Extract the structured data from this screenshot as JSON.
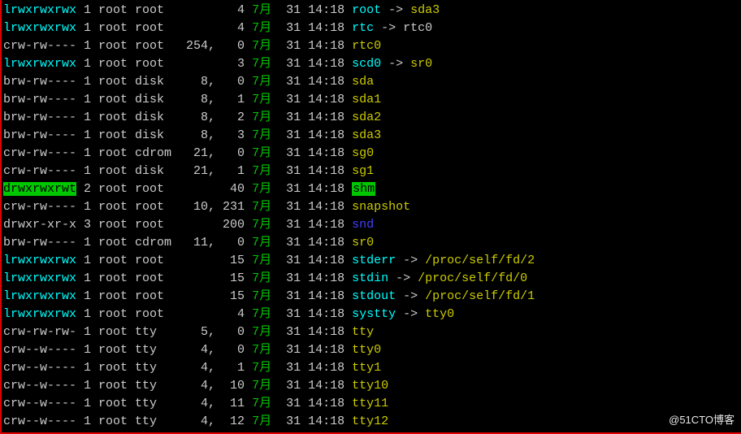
{
  "watermark": "@51CTO博客",
  "month_label": "7月",
  "rows": [
    {
      "perm": "lrwxrwxrwx",
      "perm_style": "perm-lnk",
      "links": "1",
      "owner": "root",
      "group": "root",
      "major": "",
      "size": "4",
      "day": "31",
      "time": "14:18",
      "name": "root",
      "name_style": "fname-cyan",
      "arrow": true,
      "target": "sda3",
      "target_style": "target-yellow"
    },
    {
      "perm": "lrwxrwxrwx",
      "perm_style": "perm-lnk",
      "links": "1",
      "owner": "root",
      "group": "root",
      "major": "",
      "size": "4",
      "day": "31",
      "time": "14:18",
      "name": "rtc",
      "name_style": "fname-cyan",
      "arrow": true,
      "target": "rtc0",
      "target_style": "target-plain"
    },
    {
      "perm": "crw-rw----",
      "perm_style": "plain",
      "links": "1",
      "owner": "root",
      "group": "root",
      "major": "254,",
      "size": "0",
      "day": "31",
      "time": "14:18",
      "name": "rtc0",
      "name_style": "fname-yellow",
      "arrow": false,
      "target": "",
      "target_style": ""
    },
    {
      "perm": "lrwxrwxrwx",
      "perm_style": "perm-lnk",
      "links": "1",
      "owner": "root",
      "group": "root",
      "major": "",
      "size": "3",
      "day": "31",
      "time": "14:18",
      "name": "scd0",
      "name_style": "fname-cyan",
      "arrow": true,
      "target": "sr0",
      "target_style": "target-yellow"
    },
    {
      "perm": "brw-rw----",
      "perm_style": "plain",
      "links": "1",
      "owner": "root",
      "group": "disk",
      "major": "8,",
      "size": "0",
      "day": "31",
      "time": "14:18",
      "name": "sda",
      "name_style": "fname-yellow",
      "arrow": false,
      "target": "",
      "target_style": ""
    },
    {
      "perm": "brw-rw----",
      "perm_style": "plain",
      "links": "1",
      "owner": "root",
      "group": "disk",
      "major": "8,",
      "size": "1",
      "day": "31",
      "time": "14:18",
      "name": "sda1",
      "name_style": "fname-yellow",
      "arrow": false,
      "target": "",
      "target_style": ""
    },
    {
      "perm": "brw-rw----",
      "perm_style": "plain",
      "links": "1",
      "owner": "root",
      "group": "disk",
      "major": "8,",
      "size": "2",
      "day": "31",
      "time": "14:18",
      "name": "sda2",
      "name_style": "fname-yellow",
      "arrow": false,
      "target": "",
      "target_style": ""
    },
    {
      "perm": "brw-rw----",
      "perm_style": "plain",
      "links": "1",
      "owner": "root",
      "group": "disk",
      "major": "8,",
      "size": "3",
      "day": "31",
      "time": "14:18",
      "name": "sda3",
      "name_style": "fname-yellow",
      "arrow": false,
      "target": "",
      "target_style": ""
    },
    {
      "perm": "crw-rw----",
      "perm_style": "plain",
      "links": "1",
      "owner": "root",
      "group": "cdrom",
      "major": "21,",
      "size": "0",
      "day": "31",
      "time": "14:18",
      "name": "sg0",
      "name_style": "fname-yellow",
      "arrow": false,
      "target": "",
      "target_style": ""
    },
    {
      "perm": "crw-rw----",
      "perm_style": "plain",
      "links": "1",
      "owner": "root",
      "group": "disk",
      "major": "21,",
      "size": "1",
      "day": "31",
      "time": "14:18",
      "name": "sg1",
      "name_style": "fname-yellow",
      "arrow": false,
      "target": "",
      "target_style": ""
    },
    {
      "perm": "drwxrwxrwt",
      "perm_style": "perm-drwt",
      "links": "2",
      "owner": "root",
      "group": "root",
      "major": "",
      "size": "40",
      "day": "31",
      "time": "14:18",
      "name": "shm",
      "name_style": "fname-bg-green",
      "arrow": false,
      "target": "",
      "target_style": ""
    },
    {
      "perm": "crw-rw----",
      "perm_style": "plain",
      "links": "1",
      "owner": "root",
      "group": "root",
      "major": "10,",
      "size": "231",
      "day": "31",
      "time": "14:18",
      "name": "snapshot",
      "name_style": "fname-yellow",
      "arrow": false,
      "target": "",
      "target_style": ""
    },
    {
      "perm": "drwxr-xr-x",
      "perm_style": "plain",
      "links": "3",
      "owner": "root",
      "group": "root",
      "major": "",
      "size": "200",
      "day": "31",
      "time": "14:18",
      "name": "snd",
      "name_style": "fname-blue",
      "arrow": false,
      "target": "",
      "target_style": ""
    },
    {
      "perm": "brw-rw----",
      "perm_style": "plain",
      "links": "1",
      "owner": "root",
      "group": "cdrom",
      "major": "11,",
      "size": "0",
      "day": "31",
      "time": "14:18",
      "name": "sr0",
      "name_style": "fname-yellow",
      "arrow": false,
      "target": "",
      "target_style": ""
    },
    {
      "perm": "lrwxrwxrwx",
      "perm_style": "perm-lnk",
      "links": "1",
      "owner": "root",
      "group": "root",
      "major": "",
      "size": "15",
      "day": "31",
      "time": "14:18",
      "name": "stderr",
      "name_style": "fname-cyan",
      "arrow": true,
      "target": "/proc/self/fd/2",
      "target_style": "target-yellow"
    },
    {
      "perm": "lrwxrwxrwx",
      "perm_style": "perm-lnk",
      "links": "1",
      "owner": "root",
      "group": "root",
      "major": "",
      "size": "15",
      "day": "31",
      "time": "14:18",
      "name": "stdin",
      "name_style": "fname-cyan",
      "arrow": true,
      "target": "/proc/self/fd/0",
      "target_style": "target-yellow"
    },
    {
      "perm": "lrwxrwxrwx",
      "perm_style": "perm-lnk",
      "links": "1",
      "owner": "root",
      "group": "root",
      "major": "",
      "size": "15",
      "day": "31",
      "time": "14:18",
      "name": "stdout",
      "name_style": "fname-cyan",
      "arrow": true,
      "target": "/proc/self/fd/1",
      "target_style": "target-yellow"
    },
    {
      "perm": "lrwxrwxrwx",
      "perm_style": "perm-lnk",
      "links": "1",
      "owner": "root",
      "group": "root",
      "major": "",
      "size": "4",
      "day": "31",
      "time": "14:18",
      "name": "systty",
      "name_style": "fname-cyan",
      "arrow": true,
      "target": "tty0",
      "target_style": "target-yellow"
    },
    {
      "perm": "crw-rw-rw-",
      "perm_style": "plain",
      "links": "1",
      "owner": "root",
      "group": "tty",
      "major": "5,",
      "size": "0",
      "day": "31",
      "time": "14:18",
      "name": "tty",
      "name_style": "fname-yellow",
      "arrow": false,
      "target": "",
      "target_style": ""
    },
    {
      "perm": "crw--w----",
      "perm_style": "plain",
      "links": "1",
      "owner": "root",
      "group": "tty",
      "major": "4,",
      "size": "0",
      "day": "31",
      "time": "14:18",
      "name": "tty0",
      "name_style": "fname-yellow",
      "arrow": false,
      "target": "",
      "target_style": ""
    },
    {
      "perm": "crw--w----",
      "perm_style": "plain",
      "links": "1",
      "owner": "root",
      "group": "tty",
      "major": "4,",
      "size": "1",
      "day": "31",
      "time": "14:18",
      "name": "tty1",
      "name_style": "fname-yellow",
      "arrow": false,
      "target": "",
      "target_style": ""
    },
    {
      "perm": "crw--w----",
      "perm_style": "plain",
      "links": "1",
      "owner": "root",
      "group": "tty",
      "major": "4,",
      "size": "10",
      "day": "31",
      "time": "14:18",
      "name": "tty10",
      "name_style": "fname-yellow",
      "arrow": false,
      "target": "",
      "target_style": ""
    },
    {
      "perm": "crw--w----",
      "perm_style": "plain",
      "links": "1",
      "owner": "root",
      "group": "tty",
      "major": "4,",
      "size": "11",
      "day": "31",
      "time": "14:18",
      "name": "tty11",
      "name_style": "fname-yellow",
      "arrow": false,
      "target": "",
      "target_style": ""
    },
    {
      "perm": "crw--w----",
      "perm_style": "plain",
      "links": "1",
      "owner": "root",
      "group": "tty",
      "major": "4,",
      "size": "12",
      "day": "31",
      "time": "14:18",
      "name": "tty12",
      "name_style": "fname-yellow",
      "arrow": false,
      "target": "",
      "target_style": ""
    }
  ]
}
